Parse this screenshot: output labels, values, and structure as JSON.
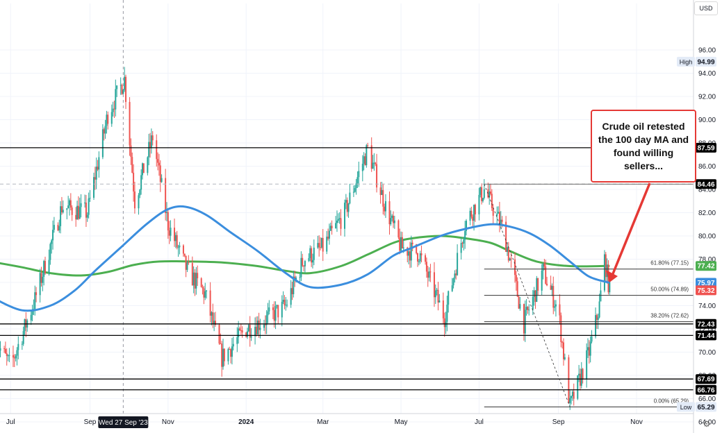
{
  "currency": "USD",
  "callout": {
    "text": "Crude oil retested the 100 day MA and found willing sellers..."
  },
  "crosshair_label": "Wed 27 Sep '23",
  "colors": {
    "up_candle": "#26a69a",
    "down_candle": "#ef5350",
    "ma100": "#3b8ede",
    "ma200": "#4caf50",
    "arrow": "#e53935"
  },
  "chart_data": {
    "type": "line",
    "title": "",
    "xlabel": "",
    "ylabel": "",
    "ylim": [
      63,
      98
    ],
    "y_ticks": [
      "64.00",
      "66.00",
      "68.00",
      "70.00",
      "72.00",
      "74.00",
      "76.00",
      "78.00",
      "80.00",
      "82.00",
      "84.00",
      "86.00",
      "88.00",
      "90.00",
      "92.00",
      "94.00",
      "96.00"
    ],
    "x_ticks": [
      "Jul",
      "Sep",
      "Nov",
      "2024",
      "Mar",
      "May",
      "Jul",
      "Sep",
      "Nov"
    ],
    "x_tick_bold": "2024",
    "series": [
      {
        "kind": "price",
        "dates": [
          "2023-06-20",
          "2023-07-01",
          "2023-07-20",
          "2023-08-10",
          "2023-08-30",
          "2023-09-15",
          "2023-09-28",
          "2023-10-06",
          "2023-10-20",
          "2023-11-01",
          "2023-11-16",
          "2023-11-30",
          "2023-12-13",
          "2024-01-01",
          "2024-01-15",
          "2024-02-01",
          "2024-02-15",
          "2024-03-01",
          "2024-03-18",
          "2024-04-05",
          "2024-04-19",
          "2024-05-01",
          "2024-05-15",
          "2024-06-04",
          "2024-06-20",
          "2024-07-05",
          "2024-07-20",
          "2024-08-05",
          "2024-08-20",
          "2024-09-01",
          "2024-09-10",
          "2024-09-25",
          "2024-10-03",
          "2024-10-07",
          "2024-10-11"
        ],
        "values": [
          70.8,
          68.8,
          74.5,
          82.5,
          82.0,
          90.5,
          93.5,
          83.0,
          88.5,
          81.0,
          77.0,
          75.0,
          69.5,
          72.0,
          72.7,
          74.0,
          78.0,
          79.0,
          82.0,
          87.5,
          82.5,
          79.0,
          78.5,
          73.0,
          81.0,
          84.0,
          80.5,
          72.5,
          77.0,
          73.5,
          65.3,
          70.0,
          74.0,
          78.0,
          75.32
        ]
      },
      {
        "name": "",
        "kind": "ma100",
        "dates": [
          "2023-06-15",
          "2023-07-10",
          "2023-08-01",
          "2023-08-20",
          "2023-09-05",
          "2023-09-25",
          "2023-10-15",
          "2023-11-01",
          "2023-11-15",
          "2023-12-01",
          "2023-12-20",
          "2024-01-10",
          "2024-02-01",
          "2024-02-20",
          "2024-03-15",
          "2024-04-05",
          "2024-04-25",
          "2024-05-10",
          "2024-06-01",
          "2024-06-20",
          "2024-07-10",
          "2024-07-25",
          "2024-08-10",
          "2024-08-25",
          "2024-09-10",
          "2024-09-25",
          "2024-10-11"
        ],
        "values": [
          74.8,
          73.6,
          74.0,
          75.3,
          77.0,
          79.0,
          81.0,
          82.3,
          82.5,
          81.8,
          80.3,
          78.7,
          76.8,
          75.6,
          75.8,
          76.7,
          78.3,
          79.0,
          80.0,
          80.6,
          81.0,
          80.8,
          80.2,
          79.2,
          77.8,
          76.5,
          75.97
        ]
      },
      {
        "name": "",
        "kind": "ma200",
        "dates": [
          "2023-06-15",
          "2023-07-10",
          "2023-08-01",
          "2023-08-25",
          "2023-09-15",
          "2023-10-05",
          "2023-10-25",
          "2023-11-20",
          "2023-12-15",
          "2024-01-10",
          "2024-02-01",
          "2024-02-20",
          "2024-03-15",
          "2024-04-05",
          "2024-04-25",
          "2024-05-10",
          "2024-06-01",
          "2024-06-20",
          "2024-07-10",
          "2024-07-25",
          "2024-08-15",
          "2024-09-10",
          "2024-10-11"
        ],
        "values": [
          77.8,
          77.3,
          76.8,
          76.6,
          76.9,
          77.5,
          77.8,
          77.8,
          77.7,
          77.4,
          77.0,
          76.8,
          77.4,
          78.4,
          79.4,
          79.8,
          80.0,
          79.8,
          79.4,
          78.7,
          77.8,
          77.4,
          77.42
        ]
      }
    ],
    "horizontal_levels": [
      {
        "value": 87.59,
        "label": "87.59"
      },
      {
        "value": 72.43,
        "label": "72.43"
      },
      {
        "value": 71.44,
        "label": "71.44"
      },
      {
        "value": 67.69,
        "label": "67.69"
      },
      {
        "value": 66.76,
        "label": "66.76"
      }
    ],
    "dashed_levels": [
      {
        "value": 84.46,
        "label": "84.46"
      }
    ],
    "fibonacci": [
      {
        "value": 77.15,
        "label": "61.80% (77.15)"
      },
      {
        "value": 74.89,
        "label": "50.00% (74.89)"
      },
      {
        "value": 72.62,
        "label": "38.20% (72.62)"
      },
      {
        "value": 65.29,
        "label": "0.00% (65.29)"
      }
    ],
    "badges": [
      {
        "value": 94.99,
        "label": "94.99",
        "prefix": "High"
      },
      {
        "value": 87.59,
        "label": "87.59"
      },
      {
        "value": 84.46,
        "label": "84.46"
      },
      {
        "value": 77.42,
        "label": "77.42"
      },
      {
        "value": 75.97,
        "label": "75.97"
      },
      {
        "value": 75.32,
        "label": "75.32"
      },
      {
        "value": 72.43,
        "label": "72.43"
      },
      {
        "value": 71.44,
        "label": "71.44"
      },
      {
        "value": 67.69,
        "label": "67.69"
      },
      {
        "value": 66.76,
        "label": "66.76"
      },
      {
        "value": 65.29,
        "label": "65.29",
        "prefix": "Low"
      }
    ]
  }
}
